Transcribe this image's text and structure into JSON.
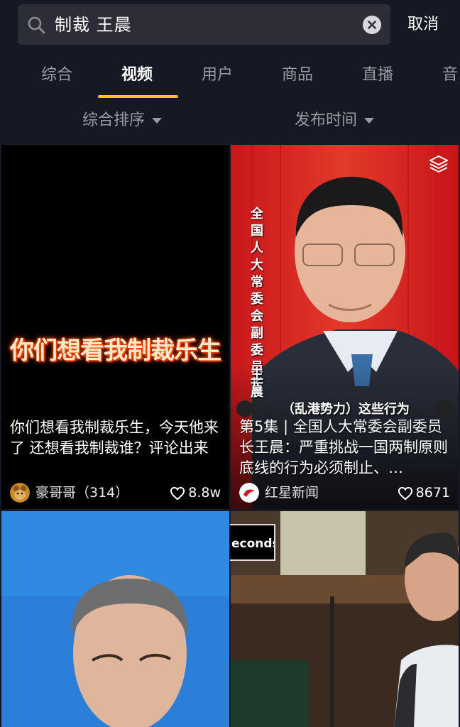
{
  "search": {
    "query": "制裁 王晨",
    "cancel_label": "取消"
  },
  "tabs": [
    {
      "label": "综合",
      "active": false
    },
    {
      "label": "视频",
      "active": true
    },
    {
      "label": "用户",
      "active": false
    },
    {
      "label": "商品",
      "active": false
    },
    {
      "label": "直播",
      "active": false
    },
    {
      "label": "音",
      "active": false
    }
  ],
  "filters": {
    "sort_label": "综合排序",
    "time_label": "发布时间"
  },
  "videos": [
    {
      "overlay_text": "你们想看我制裁乐生",
      "caption": "你们想看我制裁乐生，今天他来了 还想看我制裁谁？评论出来",
      "author": "豪哥哥（314）",
      "likes": "8.8w"
    },
    {
      "vertical_text": "全国人大常委会副委员长",
      "vertical_name": "王晨",
      "subtitle": "（乱港势力）这些行为",
      "caption": "第5集 | 全国人大常委会副委员长王晨：严重挑战一国两制原则底线的行为必须制止、…",
      "author": "红星新闻",
      "likes": "8671"
    },
    {
      "caption": ""
    },
    {
      "corner_text": "econds"
    }
  ],
  "colors": {
    "background": "#161823",
    "accent_underline": "#f5c518",
    "inactive_text": "#9a9ba1"
  },
  "icons": [
    "search-icon",
    "clear-icon",
    "caret-down-icon",
    "heart-icon",
    "stack-icon"
  ]
}
